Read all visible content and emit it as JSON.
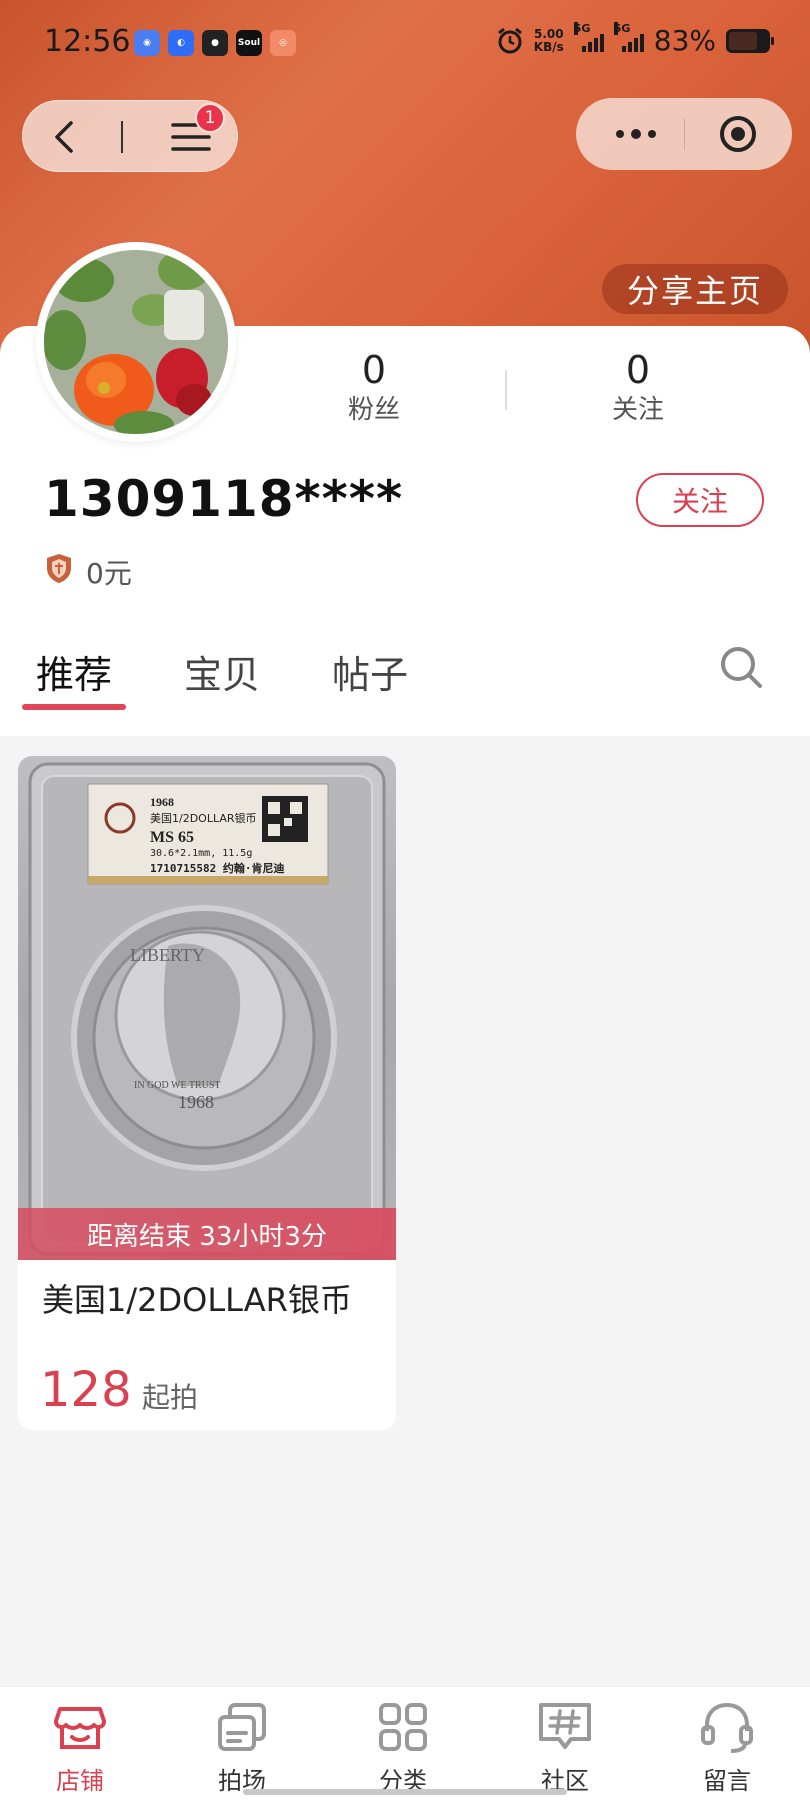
{
  "status_bar": {
    "time": "12:56",
    "net_speed_value": "5.00",
    "net_speed_unit": "KB/s",
    "signal_label_1": "5G",
    "signal_label_2": "5G",
    "battery": "83%",
    "app_icons": [
      "qq-browser-icon",
      "baidu-icon",
      "qq-icon",
      "soul-icon",
      "camera-app-icon"
    ],
    "soul_label": "Soul"
  },
  "nav_capsule": {
    "badge_count": "1"
  },
  "header": {
    "share_label": "分享主页"
  },
  "profile": {
    "username": "1309118****",
    "followers_count": "0",
    "followers_label": "粉丝",
    "following_count": "0",
    "following_label": "关注",
    "follow_button": "关注",
    "balance": "0元"
  },
  "tabs": [
    {
      "label": "推荐",
      "active": true
    },
    {
      "label": "宝贝",
      "active": false
    },
    {
      "label": "帖子",
      "active": false
    }
  ],
  "products": [
    {
      "countdown": "距离结束 33小时3分",
      "title": "美国1/2DOLLAR银币",
      "price": "128",
      "price_suffix": "起拍",
      "slab_label": {
        "year": "1968",
        "name": "美国1/2DOLLAR银币",
        "grade": "MS 65",
        "specs": "30.6*2.1mm, 11.5g",
        "serial": "1710715582 约翰·肯尼迪"
      },
      "coin_text": {
        "liberty": "LIBERTY",
        "motto": "IN GOD WE TRUST",
        "year": "1968"
      }
    }
  ],
  "bottom_nav": [
    {
      "label": "店铺",
      "icon": "shop-icon",
      "active": true
    },
    {
      "label": "拍场",
      "icon": "auction-icon",
      "active": false
    },
    {
      "label": "分类",
      "icon": "category-icon",
      "active": false
    },
    {
      "label": "社区",
      "icon": "community-icon",
      "active": false
    },
    {
      "label": "留言",
      "icon": "headset-icon",
      "active": false
    }
  ],
  "colors": {
    "accent": "#d94050",
    "header": "#d9623a",
    "badge": "#e8334a"
  }
}
